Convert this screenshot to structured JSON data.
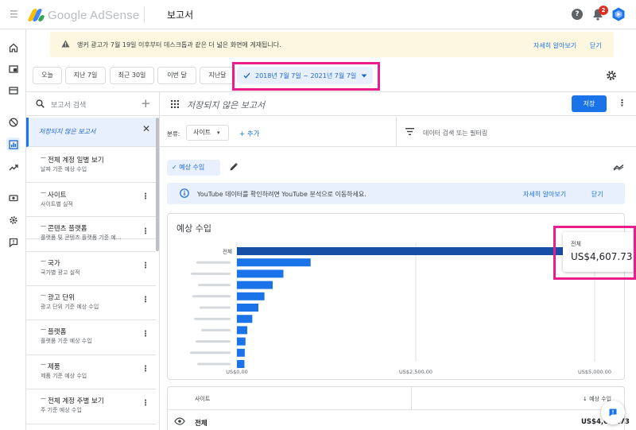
{
  "header": {
    "logo_text": "Google AdSense",
    "page_title": "보고서",
    "help_label": "?",
    "notification_count": "2"
  },
  "rail": {
    "icons": [
      "home-icon",
      "ads-icon",
      "sites-icon",
      "block-icon",
      "reports-icon",
      "optimization-icon",
      "payments-icon",
      "settings-icon",
      "feedback-icon"
    ],
    "active_index": 4
  },
  "banner": {
    "message": "앵커 광고가 7월 19일 이후부터 데스크톱과 같은 더 넓은 화면에 게재됩니다.",
    "learn_more": "자세히 알아보기",
    "close": "닫기"
  },
  "date_chips": [
    "오늘",
    "지난 7일",
    "최근 30일",
    "이번 달",
    "지난달"
  ],
  "date_range": "2018년 7월 7일 ~ 2021년 7월 7일",
  "reports": {
    "search_placeholder": "보고서 검색",
    "items": [
      {
        "name": "저장되지 않은 보고서",
        "sub": "",
        "selected": true
      },
      {
        "name": "전체 계정 일별 보기",
        "sub": "날짜 기준 예상 수입"
      },
      {
        "name": "사이트",
        "sub": "사이트별 실적"
      },
      {
        "name": "콘텐츠 플랫폼",
        "sub": "플랫폼 및 콘텐츠 플랫폼 기준 예..."
      },
      {
        "name": "국가",
        "sub": "국가별 광고 실적"
      },
      {
        "name": "광고 단위",
        "sub": "광고 단위 기준 예상 수입"
      },
      {
        "name": "플랫폼",
        "sub": "플랫폼 기준 예상 수입"
      },
      {
        "name": "제품",
        "sub": "제품 기준 예상 수입"
      },
      {
        "name": "전체 계정 주별 보기",
        "sub": "주 기준 예상 수입"
      }
    ]
  },
  "main": {
    "report_title": "저장되지 않은 보고서",
    "save_label": "저장",
    "breakdown_label": "분류:",
    "breakdown_value": "사이트",
    "add_label": "추가",
    "filter_placeholder": "데이터 검색 또는 필터링",
    "metric_chip": "예상 수입",
    "yt_message": "YouTube 데이터를 확인하려면 YouTube 분석으로 이동하세요.",
    "yt_learn_more": "자세히 알아보기",
    "yt_close": "닫기",
    "chart_title": "예상 수입",
    "tooltip_label": "전체",
    "tooltip_value": "US$4,607.73",
    "table_header_site": "사이트",
    "table_header_metric": "예상 수입",
    "table_row_label": "전체",
    "table_row_value": "US$4,607.73"
  },
  "chart_data": {
    "type": "bar",
    "orientation": "horizontal",
    "title": "예상 수입",
    "categories": [
      "전체",
      "",
      "",
      "",
      "",
      "",
      "",
      "",
      "",
      "",
      ""
    ],
    "values": [
      4607.73,
      1030,
      650,
      500,
      385,
      300,
      215,
      145,
      120,
      110,
      105
    ],
    "xticks": [
      "US$0.00",
      "US$2,500.00",
      "US$5,000.00"
    ],
    "xlim": [
      0,
      5000
    ],
    "colors": {
      "total": "#174ea6",
      "bar": "#1a73e8"
    }
  }
}
